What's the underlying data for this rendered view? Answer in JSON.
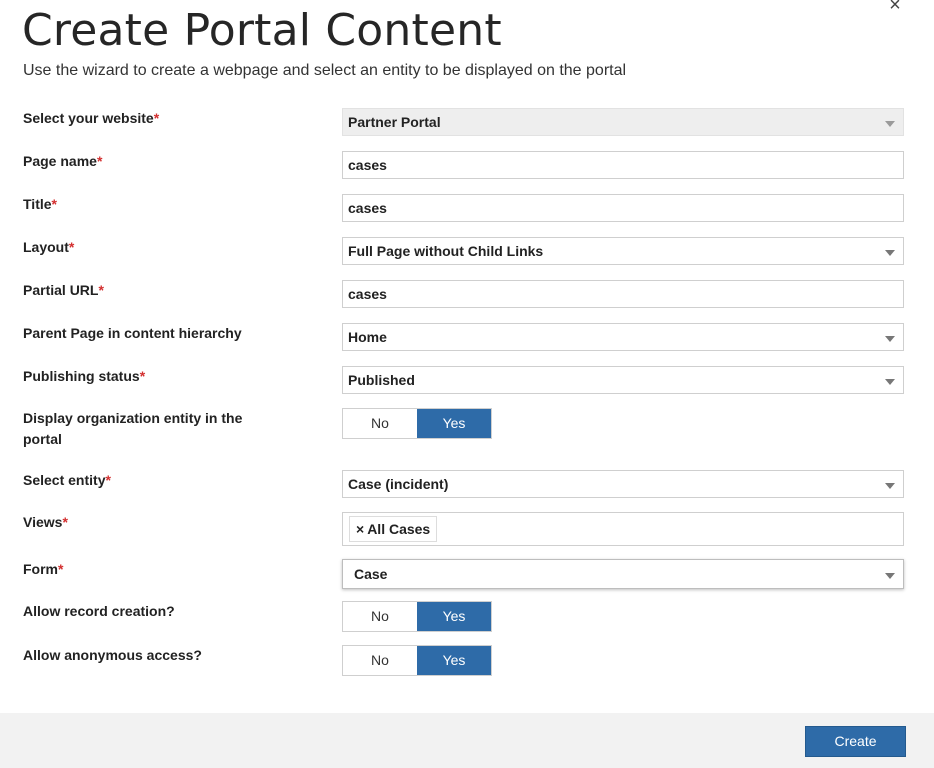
{
  "dialog": {
    "title": "Create Portal Content",
    "subtitle": "Use the wizard to create a webpage and select an entity to be displayed on the portal",
    "close_glyph": "×",
    "close_icon": "close-icon"
  },
  "required_marker": "*",
  "fields": {
    "website": {
      "label": "Select your website",
      "value": "Partner Portal"
    },
    "page_name": {
      "label": "Page name",
      "value": "cases"
    },
    "title": {
      "label": "Title",
      "value": "cases"
    },
    "layout": {
      "label": "Layout",
      "value": "Full Page without Child Links"
    },
    "partial_url": {
      "label": "Partial URL",
      "value": "cases"
    },
    "parent_page": {
      "label": "Parent Page in content hierarchy",
      "value": "Home"
    },
    "publishing_status": {
      "label": "Publishing status",
      "value": "Published"
    },
    "display_org_entity": {
      "label": "Display organization entity in the portal",
      "no": "No",
      "yes": "Yes",
      "selected": "Yes"
    },
    "select_entity": {
      "label": "Select entity",
      "value": "Case (incident)"
    },
    "views": {
      "label": "Views",
      "tags": [
        {
          "remove": "×",
          "label": "All Cases"
        }
      ]
    },
    "form": {
      "label": "Form",
      "value": "Case"
    },
    "allow_record_creation": {
      "label": "Allow record creation?",
      "no": "No",
      "yes": "Yes",
      "selected": "Yes"
    },
    "allow_anonymous_access": {
      "label": "Allow anonymous access?",
      "no": "No",
      "yes": "Yes",
      "selected": "Yes"
    }
  },
  "footer": {
    "create_label": "Create"
  },
  "colors": {
    "accent": "#2e6ba8",
    "required": "#d32f2f",
    "footer_bg": "#f2f2f2",
    "disabled_bg": "#eeeeee"
  }
}
